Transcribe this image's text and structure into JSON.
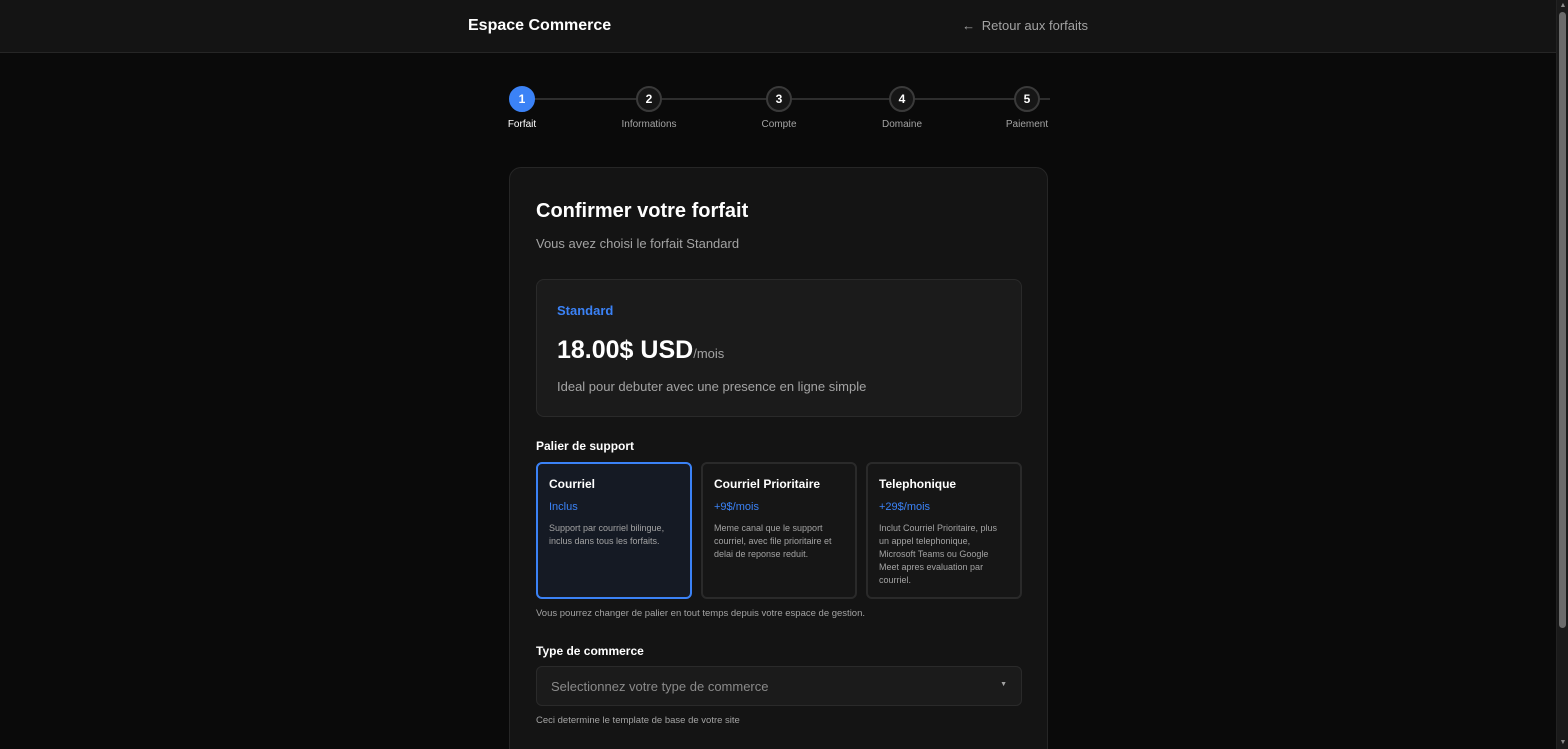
{
  "header": {
    "brand": "Espace Commerce",
    "back_arrow": "←",
    "back_label": "Retour aux forfaits"
  },
  "stepper": {
    "steps": [
      {
        "number": "1",
        "label": "Forfait",
        "active": true
      },
      {
        "number": "2",
        "label": "Informations",
        "active": false
      },
      {
        "number": "3",
        "label": "Compte",
        "active": false
      },
      {
        "number": "4",
        "label": "Domaine",
        "active": false
      },
      {
        "number": "5",
        "label": "Paiement",
        "active": false
      }
    ]
  },
  "card": {
    "title": "Confirmer votre forfait",
    "subtitle": "Vous avez choisi le forfait Standard"
  },
  "plan": {
    "name": "Standard",
    "price": "18.00$ USD",
    "period": "/mois",
    "description": "Ideal pour debuter avec une presence en ligne simple"
  },
  "support": {
    "label": "Palier de support",
    "options": [
      {
        "name": "Courriel",
        "price": "Inclus",
        "description": "Support par courriel bilingue, inclus dans tous les forfaits.",
        "selected": true
      },
      {
        "name": "Courriel Prioritaire",
        "price": "+9$/mois",
        "description": "Meme canal que le support courriel, avec file prioritaire et delai de reponse reduit.",
        "selected": false
      },
      {
        "name": "Telephonique",
        "price": "+29$/mois",
        "description": "Inclut Courriel Prioritaire, plus un appel telephonique, Microsoft Teams ou Google Meet apres evaluation par courriel.",
        "selected": false
      }
    ],
    "helper": "Vous pourrez changer de palier en tout temps depuis votre espace de gestion."
  },
  "commerce": {
    "label": "Type de commerce",
    "placeholder": "Selectionnez votre type de commerce",
    "caret": "▼",
    "helper": "Ceci determine le template de base de votre site"
  },
  "colors": {
    "accent": "#3b82f6",
    "background": "#0a0a0a",
    "card": "#141414"
  }
}
